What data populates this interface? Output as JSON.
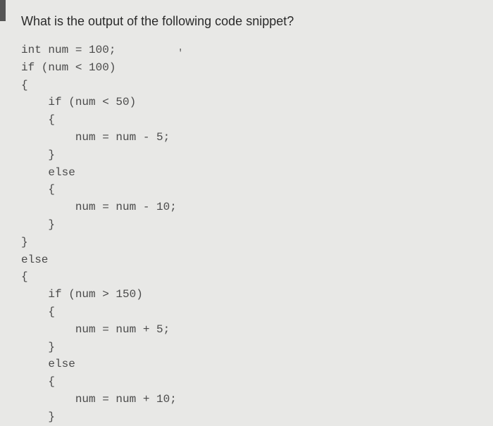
{
  "question": "What is the output of the following code snippet?",
  "accent_mark": "'",
  "code": {
    "l01": "int num = 100;",
    "l02": "if (num < 100)",
    "l03": "{",
    "l04": "    if (num < 50)",
    "l05": "    {",
    "l06": "        num = num - 5;",
    "l07": "    }",
    "l08": "    else",
    "l09": "    {",
    "l10": "        num = num - 10;",
    "l11": "    }",
    "l12": "}",
    "l13": "else",
    "l14": "{",
    "l15": "    if (num > 150)",
    "l16": "    {",
    "l17": "        num = num + 5;",
    "l18": "    }",
    "l19": "    else",
    "l20": "    {",
    "l21": "        num = num + 10;",
    "l22": "    }"
  }
}
